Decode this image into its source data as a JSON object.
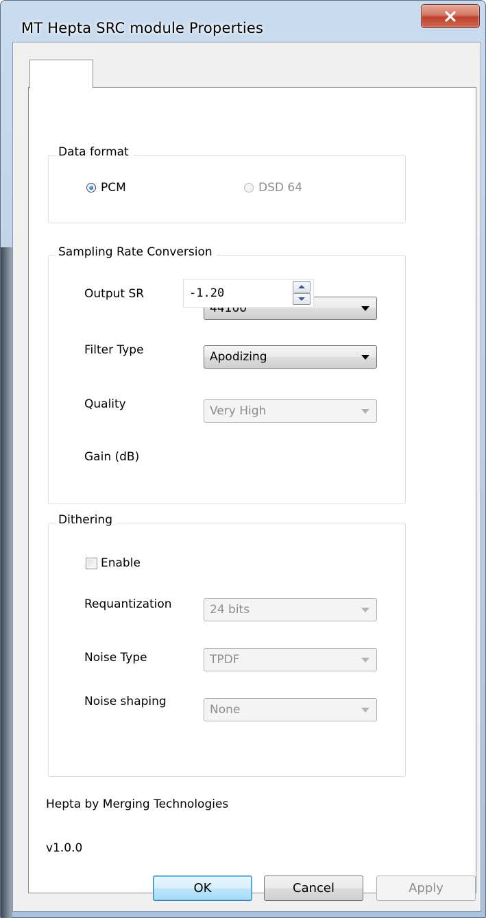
{
  "window": {
    "title": "MT Hepta SRC module Properties"
  },
  "tab": {
    "label": ""
  },
  "data_format": {
    "title": "Data format",
    "options": [
      {
        "label": "PCM",
        "selected": true,
        "enabled": true
      },
      {
        "label": "DSD 64",
        "selected": false,
        "enabled": false
      }
    ]
  },
  "src": {
    "title": "Sampling Rate Conversion",
    "output_sr": {
      "label": "Output SR",
      "value": "44100"
    },
    "filter_type": {
      "label": "Filter Type",
      "value": "Apodizing"
    },
    "quality": {
      "label": "Quality",
      "value": "Very High"
    },
    "gain": {
      "label": "Gain (dB)",
      "value": "-1.20"
    }
  },
  "dithering": {
    "title": "Dithering",
    "enable": {
      "label": "Enable",
      "checked": false
    },
    "requantization": {
      "label": "Requantization",
      "value": "24 bits"
    },
    "noise_type": {
      "label": "Noise Type",
      "value": "TPDF"
    },
    "noise_shaping": {
      "label": "Noise shaping",
      "value": "None"
    }
  },
  "footer": {
    "credit": "Hepta by Merging Technologies",
    "version": "v1.0.0"
  },
  "buttons": {
    "ok": "OK",
    "cancel": "Cancel",
    "apply": "Apply"
  },
  "icons": {
    "close": "close-icon",
    "spin_up": "spin-up-icon",
    "spin_down": "spin-down-icon",
    "dropdown_arrow": "chevron-down-icon"
  },
  "colors": {
    "close_button": "#c0402d",
    "default_button_border": "#3c7fb1",
    "group_border": "#d5dfe5",
    "disabled_text": "#8d8d8d"
  }
}
